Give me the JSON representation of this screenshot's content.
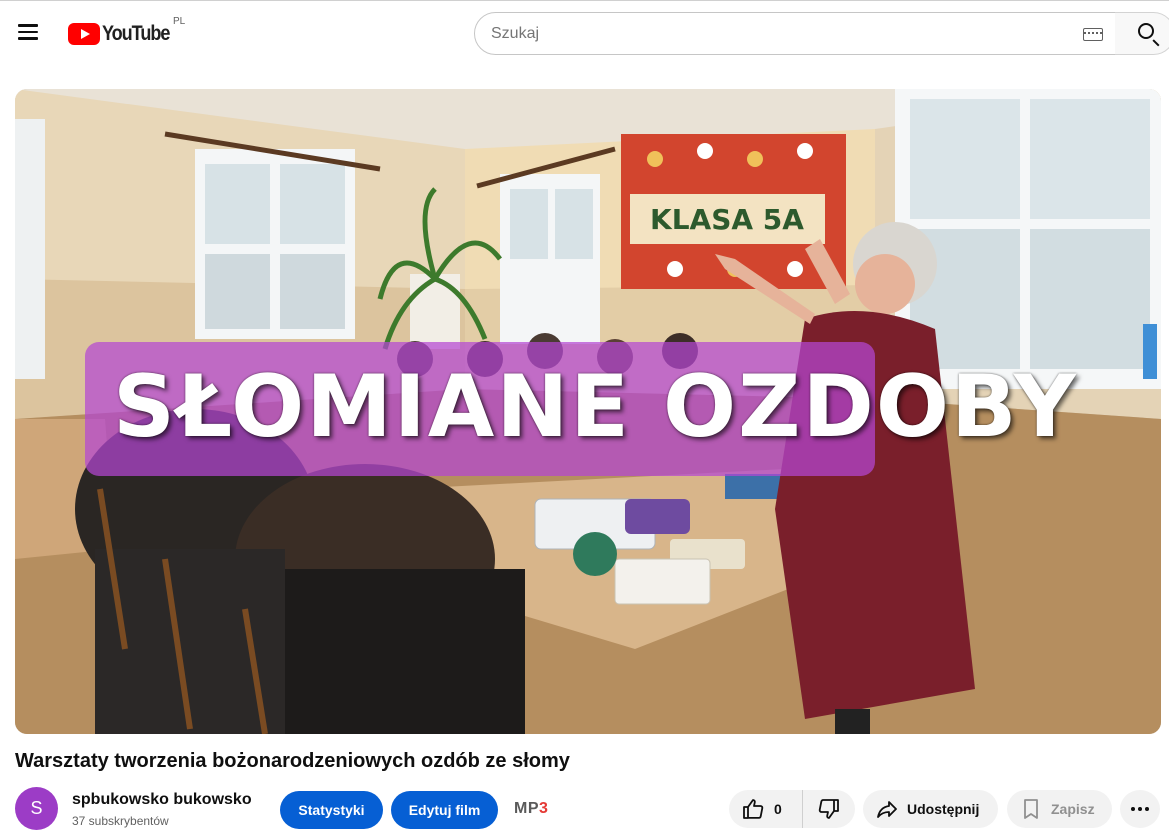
{
  "header": {
    "logo_text": "YouTube",
    "country_code": "PL",
    "search_placeholder": "Szukaj"
  },
  "video": {
    "thumbnail_overlay_text": "SŁOMIANE OZDOBY",
    "board_text": "KLASA 5A",
    "title": "Warsztaty tworzenia bożonarodzeniowych ozdób ze słomy"
  },
  "channel": {
    "avatar_letter": "S",
    "name": "spbukowsko bukowsko",
    "subscribers": "37 subskrybentów",
    "avatar_color": "#9c3cc6"
  },
  "actions": {
    "stats_label": "Statystyki",
    "edit_label": "Edytuj film",
    "mp3_label": "MP",
    "mp3_suffix": "3",
    "like_count": "0",
    "share_label": "Udostępnij",
    "save_label": "Zapisz"
  },
  "colors": {
    "brand_red": "#ff0000",
    "primary_blue": "#065fd4",
    "overlay_purple": "#b446d2"
  }
}
